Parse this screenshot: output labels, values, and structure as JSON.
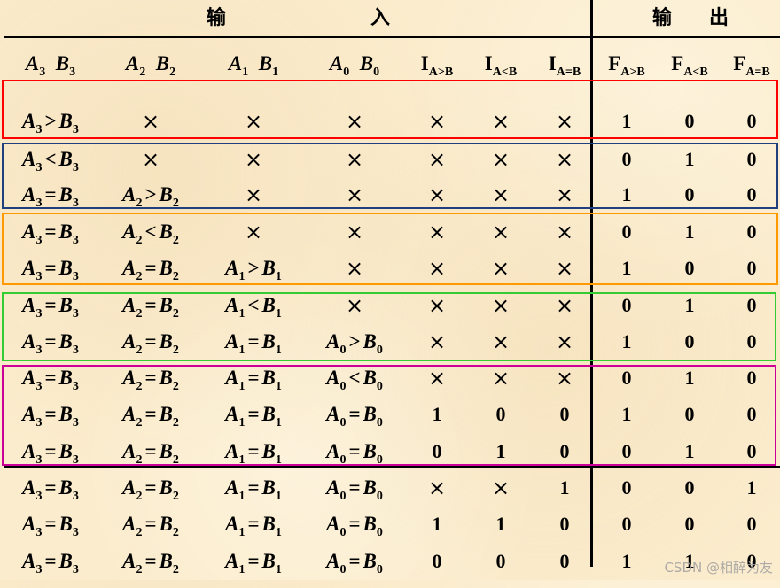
{
  "header": {
    "input_char1": "输",
    "input_char2": "入",
    "output_char1": "输",
    "output_char2": "出"
  },
  "columns": [
    {
      "main": "A",
      "sub": "3",
      "main2": "B",
      "sub2": "3"
    },
    {
      "main": "A",
      "sub": "2",
      "main2": "B",
      "sub2": "2"
    },
    {
      "main": "A",
      "sub": "1",
      "main2": "B",
      "sub2": "1"
    },
    {
      "main": "A",
      "sub": "0",
      "main2": "B",
      "sub2": "0"
    },
    {
      "main": "I",
      "sub": "A>B"
    },
    {
      "main": "I",
      "sub": "A<B"
    },
    {
      "main": "I",
      "sub": "A=B"
    },
    {
      "main": "F",
      "sub": "A>B"
    },
    {
      "main": "F",
      "sub": "A<B"
    },
    {
      "main": "F",
      "sub": "A=B"
    }
  ],
  "rows": [
    [
      "A3>B3",
      "×",
      "×",
      "×",
      "×",
      "×",
      "×",
      "1",
      "0",
      "0"
    ],
    [
      "A3<B3",
      "×",
      "×",
      "×",
      "×",
      "×",
      "×",
      "0",
      "1",
      "0"
    ],
    [
      "A3=B3",
      "A2>B2",
      "×",
      "×",
      "×",
      "×",
      "×",
      "1",
      "0",
      "0"
    ],
    [
      "A3=B3",
      "A2<B2",
      "×",
      "×",
      "×",
      "×",
      "×",
      "0",
      "1",
      "0"
    ],
    [
      "A3=B3",
      "A2=B2",
      "A1>B1",
      "×",
      "×",
      "×",
      "×",
      "1",
      "0",
      "0"
    ],
    [
      "A3=B3",
      "A2=B2",
      "A1<B1",
      "×",
      "×",
      "×",
      "×",
      "0",
      "1",
      "0"
    ],
    [
      "A3=B3",
      "A2=B2",
      "A1=B1",
      "A0>B0",
      "×",
      "×",
      "×",
      "1",
      "0",
      "0"
    ],
    [
      "A3=B3",
      "A2=B2",
      "A1=B1",
      "A0<B0",
      "×",
      "×",
      "×",
      "0",
      "1",
      "0"
    ],
    [
      "A3=B3",
      "A2=B2",
      "A1=B1",
      "A0=B0",
      "1",
      "0",
      "0",
      "1",
      "0",
      "0"
    ],
    [
      "A3=B3",
      "A2=B2",
      "A1=B1",
      "A0=B0",
      "0",
      "1",
      "0",
      "0",
      "1",
      "0"
    ],
    [
      "A3=B3",
      "A2=B2",
      "A1=B1",
      "A0=B0",
      "×",
      "×",
      "1",
      "0",
      "0",
      "1"
    ],
    [
      "A3=B3",
      "A2=B2",
      "A1=B1",
      "A0=B0",
      "1",
      "1",
      "0",
      "0",
      "0",
      "0"
    ],
    [
      "A3=B3",
      "A2=B2",
      "A1=B1",
      "A0=B0",
      "0",
      "0",
      "0",
      "1",
      "1",
      "0"
    ]
  ],
  "group_colors": [
    "#ff0000",
    "#1f3f7f",
    "#ff9900",
    "#33cc33",
    "#cc0099"
  ],
  "watermark": "CSDN @相醉为友"
}
